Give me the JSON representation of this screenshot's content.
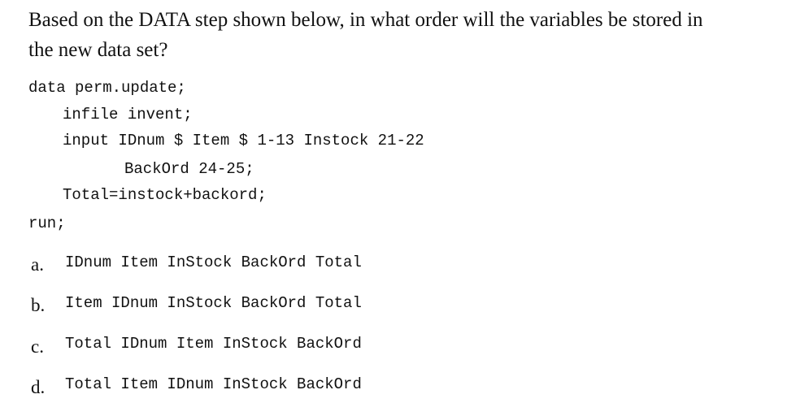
{
  "question": {
    "text": "Based on the DATA step shown below, in what order will the variables be stored in\nthe new data set?"
  },
  "code": {
    "lines": [
      "data perm.update;",
      "infile invent;",
      "input IDnum $ Item $ 1-13 Instock 21-22",
      "BackOrd 24-25;",
      "Total=instock+backord;",
      "run;"
    ]
  },
  "options": [
    {
      "letter": "a.",
      "text": "IDnum Item InStock BackOrd Total"
    },
    {
      "letter": "b.",
      "text": "Item IDnum InStock BackOrd Total"
    },
    {
      "letter": "c.",
      "text": "Total IDnum Item InStock BackOrd"
    },
    {
      "letter": "d.",
      "text": "Total Item IDnum InStock BackOrd"
    }
  ]
}
